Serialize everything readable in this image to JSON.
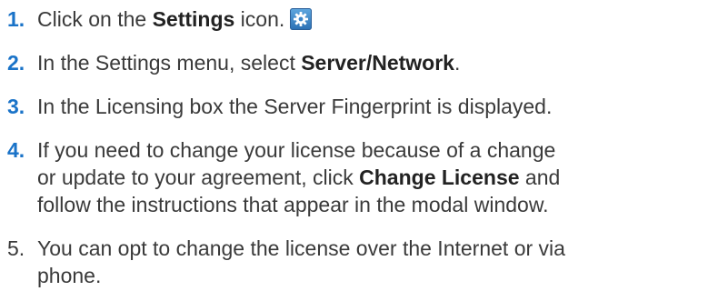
{
  "steps": [
    {
      "number": "1.",
      "before": "Click on the ",
      "bold": "Settings",
      "after": " icon.",
      "icon": "gear-icon"
    },
    {
      "number": "2.",
      "before": "In the Settings menu, select ",
      "bold": "Server/Network",
      "after": "."
    },
    {
      "number": "3.",
      "text": "In the Licensing box the Server Fingerprint is displayed."
    },
    {
      "number": "4.",
      "line1": "If you need to change your license because of a change",
      "line2_before": "or update to your agreement, click ",
      "line2_bold": "Change License",
      "line2_after": " and",
      "line3": "follow the instructions that appear in the modal window."
    },
    {
      "number": "5.",
      "line1": "You can opt to change the license over the Internet or via",
      "line2": "phone."
    }
  ],
  "colors": {
    "step_number": "#1a73c8",
    "text": "#3a3a3a",
    "icon_background": "#2b6fb3"
  }
}
